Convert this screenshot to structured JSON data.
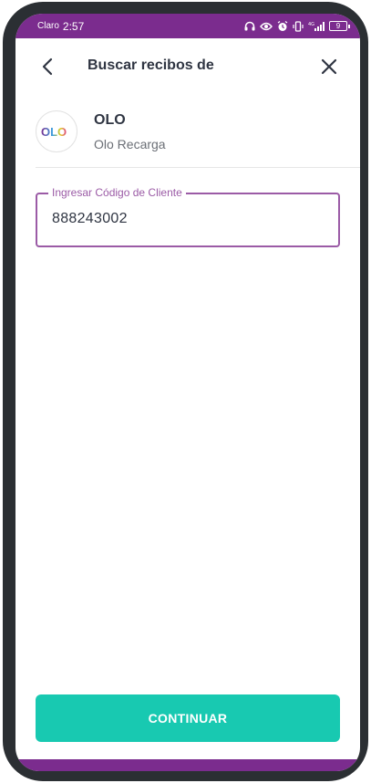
{
  "status_bar": {
    "carrier": "Claro",
    "time": "2:57",
    "network": "4G",
    "battery_level": "9",
    "icons": [
      "headphones-icon",
      "eye-icon",
      "alarm-icon",
      "vibrate-icon",
      "signal-icon",
      "battery-icon"
    ]
  },
  "header": {
    "title": "Buscar recibos de",
    "back_icon": "chevron-left-icon",
    "close_icon": "close-icon"
  },
  "biller": {
    "name": "OLO",
    "subtitle": "Olo Recarga",
    "logo_text": "OLO"
  },
  "client_code_field": {
    "label": "Ingresar Código de Cliente",
    "value": "888243002"
  },
  "actions": {
    "continue_label": "CONTINUAR"
  },
  "colors": {
    "status_bar": "#7b2c8e",
    "field_border": "#9b5ba6",
    "primary_button": "#18c9b1",
    "title_text": "#2f3542"
  }
}
